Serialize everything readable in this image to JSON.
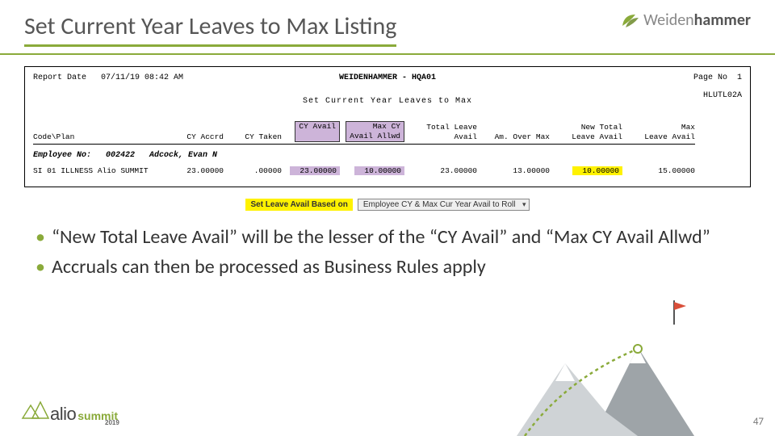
{
  "header": {
    "title": "Set Current Year Leaves to Max Listing",
    "brand_thin": "Weiden",
    "brand_bold": "hammer"
  },
  "report": {
    "report_date_label": "Report Date",
    "report_date_value": "07/11/19 08:42 AM",
    "center_title": "WEIDENHAMMER - HQA01",
    "page_label": "Page No",
    "page_value": "1",
    "subtitle": "Set Current Year Leaves to Max",
    "code": "HLUTL02A",
    "columns": {
      "codeplan": "Code\\Plan",
      "accrd": "CY Accrd",
      "taken": "CY Taken",
      "avail": "CY Avail",
      "maxcy": "Max CY\nAvail Allwd",
      "tla": "Total Leave\nAvail",
      "amover": "Am. Over Max",
      "newtla": "New Total\nLeave Avail",
      "maxla": "Max\nLeave Avail"
    },
    "employee": {
      "label": "Employee No:",
      "no": "002422",
      "name": "Adcock, Evan N"
    },
    "row": {
      "codeplan": "SI 01 ILLNESS Alio SUMMIT",
      "accrd": "23.00000",
      "taken": ".00000",
      "avail": "23.00000",
      "maxcy": "10.00000",
      "tla": "23.00000",
      "amover": "13.00000",
      "newtla": "10.00000",
      "maxla": "15.00000"
    }
  },
  "dropdown": {
    "label": "Set Leave Avail Based on",
    "value": "Employee CY & Max Cur Year Avail to Roll"
  },
  "bullets": [
    "“New Total Leave Avail” will be the lesser of the “CY Avail” and “Max CY Avail Allwd”",
    "Accruals can then be processed as Business Rules apply"
  ],
  "footer": {
    "logo_text": "alio",
    "logo_suffix": "summit",
    "logo_year": "2019",
    "page_number": "47"
  }
}
